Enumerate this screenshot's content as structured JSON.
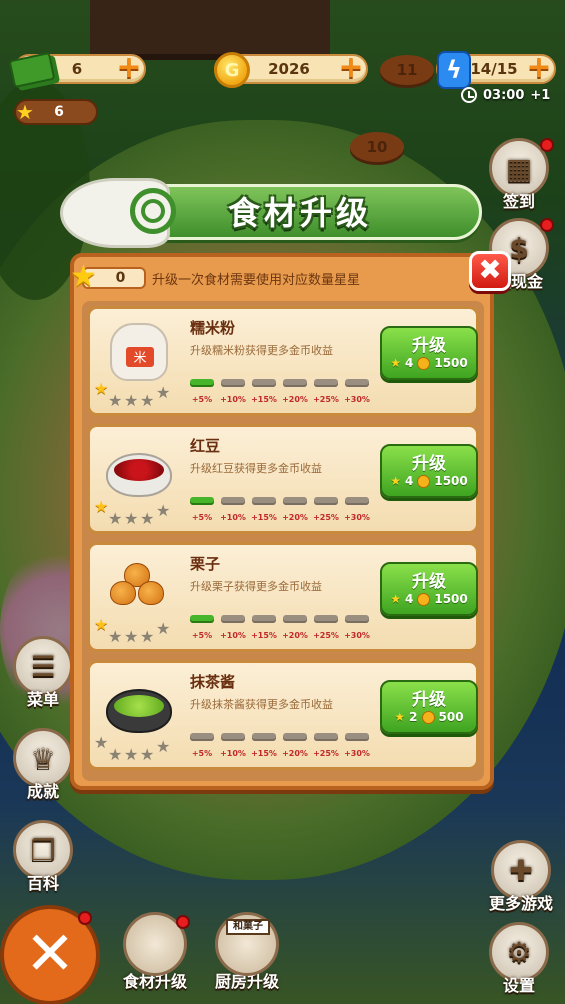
{
  "top_bar": {
    "cash": "6",
    "coins": "2026",
    "coin_glyph": "G",
    "energy": "14/15",
    "stars": "6",
    "timer": "03:00",
    "timer_bonus": "+1"
  },
  "map_steps": [
    "11",
    "10"
  ],
  "side_buttons": {
    "checkin": "签到",
    "cashout": "领现金",
    "menu": "菜单",
    "achievements": "成就",
    "encyclopedia": "百科",
    "more_games": "更多游戏",
    "settings": "设置"
  },
  "panel": {
    "title": "食材升级",
    "star_count": "0",
    "hint": "升级一次食材需要使用对应数量星星",
    "close_label": "✖",
    "upgrade_label": "升级",
    "level_bonuses": [
      "+5%",
      "+10%",
      "+15%",
      "+20%",
      "+25%",
      "+30%"
    ],
    "items": [
      {
        "name": "糯米粉",
        "desc": "升级糯米粉获得更多金币收益",
        "stars_earned": 1,
        "stars_total": 5,
        "bars_filled": 1,
        "star_cost": "4",
        "coin_cost": "1500",
        "icon": "rice-flour-bag"
      },
      {
        "name": "红豆",
        "desc": "升级红豆获得更多金币收益",
        "stars_earned": 1,
        "stars_total": 5,
        "bars_filled": 1,
        "star_cost": "4",
        "coin_cost": "1500",
        "icon": "red-bean-bowl"
      },
      {
        "name": "栗子",
        "desc": "升级栗子获得更多金币收益",
        "stars_earned": 1,
        "stars_total": 5,
        "bars_filled": 1,
        "star_cost": "4",
        "coin_cost": "1500",
        "icon": "chestnuts"
      },
      {
        "name": "抹茶酱",
        "desc": "升级抹茶酱获得更多金币收益",
        "stars_earned": 0,
        "stars_total": 5,
        "bars_filled": 0,
        "star_cost": "2",
        "coin_cost": "500",
        "icon": "matcha-sauce-bowl"
      }
    ]
  },
  "bottom_bar": {
    "close_label": "✕",
    "ingredient_upgrade": "食材升级",
    "kitchen_upgrade": "厨房升级",
    "shop_sign": "和菓子"
  },
  "colors": {
    "accent_green": "#3fa421",
    "panel_orange": "#e89b4d",
    "notify_red": "#e81e1e"
  }
}
